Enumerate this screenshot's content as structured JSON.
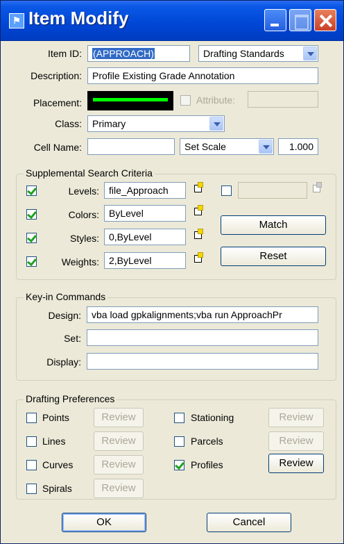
{
  "window": {
    "title": "Item Modify"
  },
  "form": {
    "item_id_label": "Item ID:",
    "item_id_value": "(APPROACH)",
    "standards_select": "Drafting Standards",
    "description_label": "Description:",
    "description_value": "Profile Existing Grade Annotation",
    "placement_label": "Placement:",
    "placement_color": "#00ff00",
    "attribute_label": "Attribute:",
    "attribute_value": "",
    "class_label": "Class:",
    "class_value": "Primary",
    "cell_name_label": "Cell Name:",
    "cell_name_value": "",
    "scale_select": "Set Scale",
    "scale_value": "1.000"
  },
  "supplemental": {
    "title": "Supplemental Search Criteria",
    "rows": [
      {
        "label": "Levels:",
        "value": "file_Approach",
        "checked": true
      },
      {
        "label": "Colors:",
        "value": "ByLevel",
        "checked": true
      },
      {
        "label": "Styles:",
        "value": "0,ByLevel",
        "checked": true
      },
      {
        "label": "Weights:",
        "value": "2,ByLevel",
        "checked": true
      }
    ],
    "extra_field_value": "",
    "match_button": "Match",
    "reset_button": "Reset"
  },
  "keyin": {
    "title": "Key-in Commands",
    "design_label": "Design:",
    "design_value": "vba load gpkalignments;vba run ApproachPr",
    "set_label": "Set:",
    "set_value": "",
    "display_label": "Display:",
    "display_value": ""
  },
  "drafting": {
    "title": "Drafting Preferences",
    "left": [
      {
        "label": "Points",
        "checked": false,
        "button": "Review"
      },
      {
        "label": "Lines",
        "checked": false,
        "button": "Review"
      },
      {
        "label": "Curves",
        "checked": false,
        "button": "Review"
      },
      {
        "label": "Spirals",
        "checked": false,
        "button": "Review"
      }
    ],
    "right": [
      {
        "label": "Stationing",
        "checked": false,
        "button": "Review"
      },
      {
        "label": "Parcels",
        "checked": false,
        "button": "Review"
      },
      {
        "label": "Profiles",
        "checked": true,
        "button": "Review"
      }
    ]
  },
  "footer": {
    "ok_button": "OK",
    "cancel_button": "Cancel"
  }
}
